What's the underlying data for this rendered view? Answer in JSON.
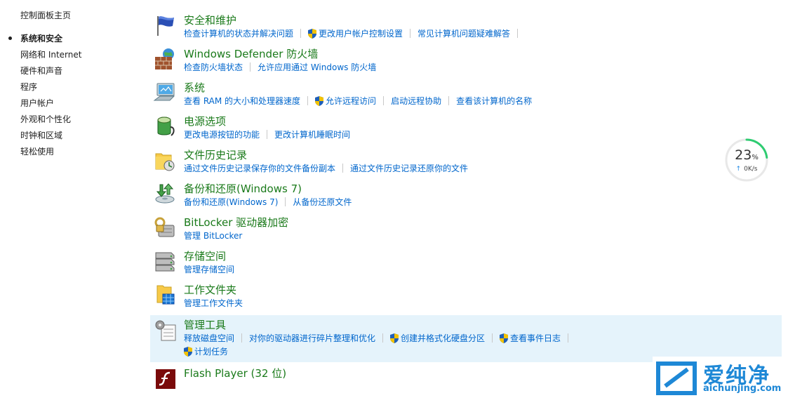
{
  "sidebar": {
    "home": "控制面板主页",
    "items": [
      {
        "label": "系统和安全",
        "active": true
      },
      {
        "label": "网络和 Internet"
      },
      {
        "label": "硬件和声音"
      },
      {
        "label": "程序"
      },
      {
        "label": "用户帐户"
      },
      {
        "label": "外观和个性化"
      },
      {
        "label": "时钟和区域"
      },
      {
        "label": "轻松使用"
      }
    ]
  },
  "categories": [
    {
      "title": "安全和维护",
      "icon": "flag-icon",
      "links": [
        {
          "label": "检查计算机的状态并解决问题"
        },
        {
          "label": "更改用户帐户控制设置",
          "shield": true
        },
        {
          "label": "常见计算机问题疑难解答"
        }
      ]
    },
    {
      "title": "Windows Defender 防火墙",
      "icon": "firewall-icon",
      "links": [
        {
          "label": "检查防火墙状态"
        },
        {
          "label": "允许应用通过 Windows 防火墙"
        }
      ]
    },
    {
      "title": "系统",
      "icon": "computer-icon",
      "links": [
        {
          "label": "查看 RAM 的大小和处理器速度"
        },
        {
          "label": "允许远程访问",
          "shield": true
        },
        {
          "label": "启动远程协助"
        },
        {
          "label": "查看该计算机的名称"
        }
      ]
    },
    {
      "title": "电源选项",
      "icon": "battery-icon",
      "links": [
        {
          "label": "更改电源按钮的功能"
        },
        {
          "label": "更改计算机睡眠时间"
        }
      ]
    },
    {
      "title": "文件历史记录",
      "icon": "file-history-icon",
      "links": [
        {
          "label": "通过文件历史记录保存你的文件备份副本"
        },
        {
          "label": "通过文件历史记录还原你的文件"
        }
      ]
    },
    {
      "title": "备份和还原(Windows 7)",
      "icon": "backup-icon",
      "links": [
        {
          "label": "备份和还原(Windows 7)"
        },
        {
          "label": "从备份还原文件"
        }
      ]
    },
    {
      "title": "BitLocker 驱动器加密",
      "icon": "bitlocker-icon",
      "links": [
        {
          "label": "管理 BitLocker"
        }
      ]
    },
    {
      "title": "存储空间",
      "icon": "storage-icon",
      "links": [
        {
          "label": "管理存储空间"
        }
      ]
    },
    {
      "title": "工作文件夹",
      "icon": "work-folders-icon",
      "links": [
        {
          "label": "管理工作文件夹"
        }
      ]
    },
    {
      "title": "管理工具",
      "icon": "admin-tools-icon",
      "links": [
        {
          "label": "释放磁盘空间"
        },
        {
          "label": "对你的驱动器进行碎片整理和优化"
        },
        {
          "label": "创建并格式化硬盘分区",
          "shield": true
        },
        {
          "label": "查看事件日志",
          "shield": true
        }
      ],
      "links2": [
        {
          "label": "计划任务",
          "shield": true
        }
      ]
    },
    {
      "title": "Flash Player (32 位)",
      "icon": "flash-icon",
      "links": []
    }
  ],
  "speed_widget": {
    "percent": "23",
    "percent_unit": "%",
    "rate": "0K/s",
    "ring_fraction": 0.23,
    "color": "#2ecc71"
  },
  "watermark": {
    "text": "爱纯净",
    "url": "aichunjing.com"
  },
  "colors": {
    "title_green": "#1a7a1a",
    "link_blue": "#0066cc",
    "highlight": "#e5f3fb"
  }
}
